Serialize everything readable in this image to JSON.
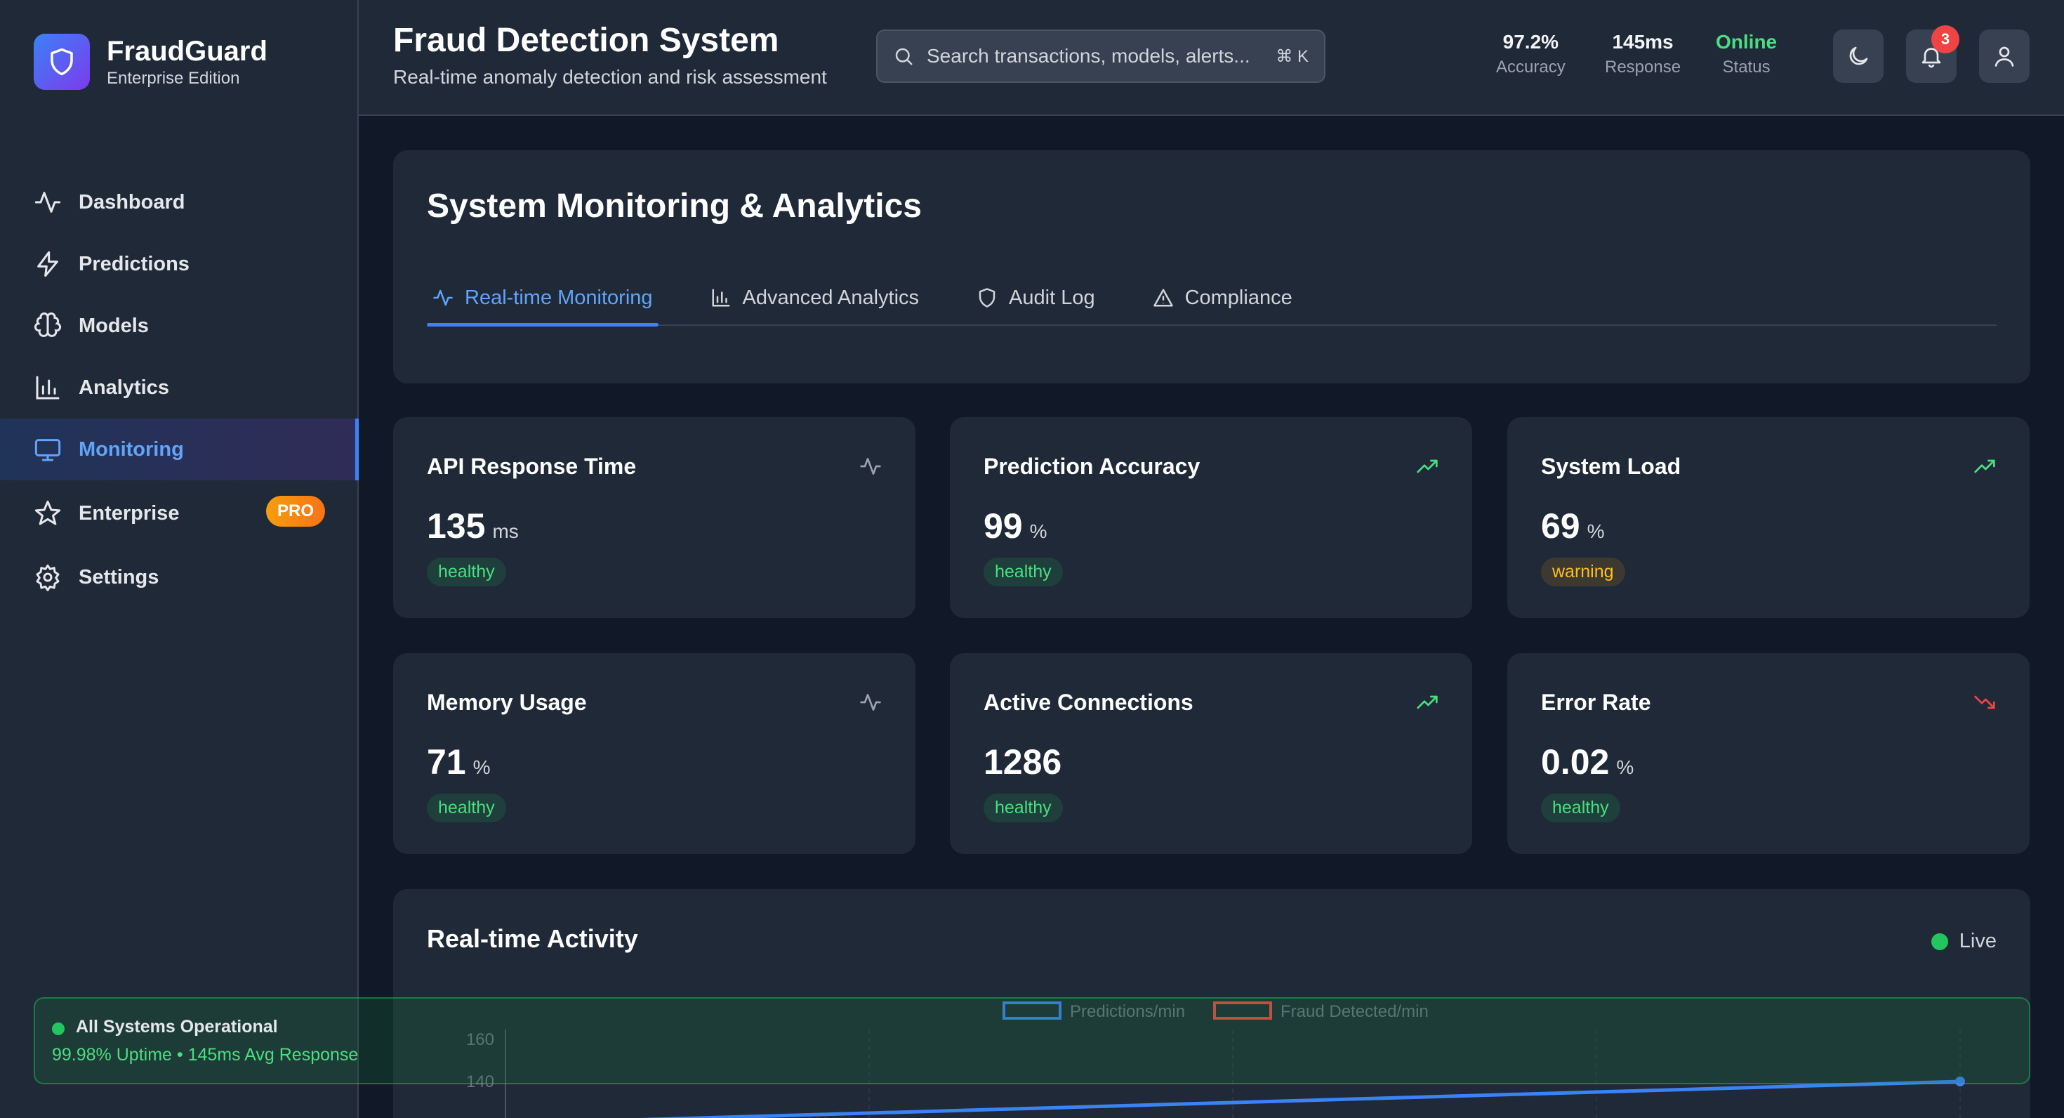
{
  "brand": {
    "name": "FraudGuard",
    "subtitle": "Enterprise Edition"
  },
  "sidebar": {
    "items": [
      {
        "label": "Dashboard",
        "icon": "activity-icon"
      },
      {
        "label": "Predictions",
        "icon": "zap-icon"
      },
      {
        "label": "Models",
        "icon": "brain-icon"
      },
      {
        "label": "Analytics",
        "icon": "bar-chart-icon"
      },
      {
        "label": "Monitoring",
        "icon": "monitor-icon",
        "active": true
      },
      {
        "label": "Enterprise",
        "icon": "star-icon",
        "badge": "PRO"
      },
      {
        "label": "Settings",
        "icon": "gear-icon"
      }
    ]
  },
  "header": {
    "title": "Fraud Detection System",
    "subtitle": "Real-time anomaly detection and risk assessment",
    "search_placeholder": "Search transactions, models, alerts...",
    "search_shortcut": "⌘ K",
    "stats": [
      {
        "value": "97.2%",
        "label": "Accuracy"
      },
      {
        "value": "145ms",
        "label": "Response"
      },
      {
        "value": "Online",
        "label": "Status"
      }
    ],
    "notification_count": "3"
  },
  "monitoring": {
    "title": "System Monitoring & Analytics",
    "tabs": [
      {
        "label": "Real-time Monitoring",
        "active": true
      },
      {
        "label": "Advanced Analytics"
      },
      {
        "label": "Audit Log"
      },
      {
        "label": "Compliance"
      }
    ]
  },
  "metrics": [
    {
      "title": "API Response Time",
      "value": "135",
      "unit": "ms",
      "status": "healthy",
      "icon": "activity-icon"
    },
    {
      "title": "Prediction Accuracy",
      "value": "99",
      "unit": "%",
      "status": "healthy",
      "icon": "trending-up-icon"
    },
    {
      "title": "System Load",
      "value": "69",
      "unit": "%",
      "status": "warning",
      "icon": "trending-up-icon"
    },
    {
      "title": "Memory Usage",
      "value": "71",
      "unit": "%",
      "status": "healthy",
      "icon": "activity-icon"
    },
    {
      "title": "Active Connections",
      "value": "1286",
      "unit": "",
      "status": "healthy",
      "icon": "trending-up-icon"
    },
    {
      "title": "Error Rate",
      "value": "0.02",
      "unit": "%",
      "status": "healthy",
      "icon": "trending-down-icon"
    }
  ],
  "activity": {
    "title": "Real-time Activity",
    "live_label": "Live"
  },
  "chart_data": {
    "type": "line",
    "title": "",
    "series": [
      {
        "name": "Predictions/min",
        "color": "#3b82f6",
        "visible_points": [
          [
            0,
            120
          ],
          [
            1,
            140
          ]
        ]
      },
      {
        "name": "Fraud Detected/min",
        "color": "#ef4444"
      }
    ],
    "y_ticks": [
      "160",
      "140"
    ],
    "grid": true,
    "legend": "top-center"
  },
  "status_banner": {
    "title": "All Systems Operational",
    "subtitle": "99.98% Uptime • 145ms Avg Response"
  },
  "colors": {
    "background": "#111827",
    "panel": "#1f2937",
    "accent": "#3b82f6",
    "healthy": "#4ade80",
    "warning": "#fbbf24",
    "danger": "#ef4444"
  }
}
